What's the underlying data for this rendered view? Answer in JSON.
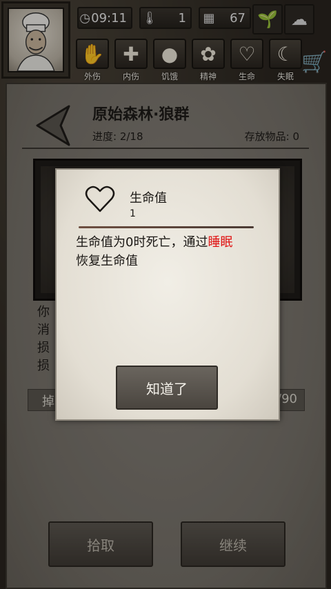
{
  "topbar": {
    "time": "09:11",
    "temperature": "1",
    "days": "67"
  },
  "status": {
    "items": [
      {
        "label": "外伤",
        "icon": "hand-icon"
      },
      {
        "label": "内伤",
        "icon": "plus-icon"
      },
      {
        "label": "饥饿",
        "icon": "stomach-icon"
      },
      {
        "label": "精神",
        "icon": "brain-icon"
      },
      {
        "label": "生命",
        "icon": "heart-icon"
      },
      {
        "label": "失眠",
        "icon": "moon-icon"
      }
    ]
  },
  "location": {
    "title": "原始森林·狼群",
    "progress": "进度: 2/18",
    "storage": "存放物品: 0"
  },
  "log_lines": [
    "你",
    "消",
    "损",
    "损"
  ],
  "bar": {
    "left": "掉",
    "right": "/90"
  },
  "buttons": {
    "pickup": "拾取",
    "continue": "继续"
  },
  "dialog": {
    "title": "生命值",
    "value": "1",
    "desc_part1": "生命值为0时死亡，通过",
    "desc_highlight": "睡眠",
    "desc_part2": "恢复生命值",
    "ok": "知道了"
  },
  "colors": {
    "highlight": "#e01010"
  }
}
